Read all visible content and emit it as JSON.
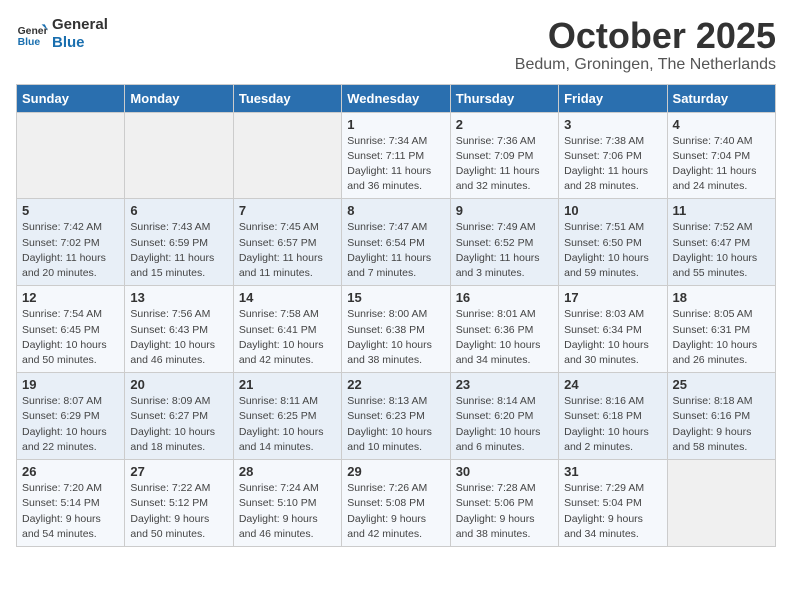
{
  "header": {
    "logo_line1": "General",
    "logo_line2": "Blue",
    "month": "October 2025",
    "location": "Bedum, Groningen, The Netherlands"
  },
  "weekdays": [
    "Sunday",
    "Monday",
    "Tuesday",
    "Wednesday",
    "Thursday",
    "Friday",
    "Saturday"
  ],
  "weeks": [
    [
      {
        "day": "",
        "info": ""
      },
      {
        "day": "",
        "info": ""
      },
      {
        "day": "",
        "info": ""
      },
      {
        "day": "1",
        "info": "Sunrise: 7:34 AM\nSunset: 7:11 PM\nDaylight: 11 hours and 36 minutes."
      },
      {
        "day": "2",
        "info": "Sunrise: 7:36 AM\nSunset: 7:09 PM\nDaylight: 11 hours and 32 minutes."
      },
      {
        "day": "3",
        "info": "Sunrise: 7:38 AM\nSunset: 7:06 PM\nDaylight: 11 hours and 28 minutes."
      },
      {
        "day": "4",
        "info": "Sunrise: 7:40 AM\nSunset: 7:04 PM\nDaylight: 11 hours and 24 minutes."
      }
    ],
    [
      {
        "day": "5",
        "info": "Sunrise: 7:42 AM\nSunset: 7:02 PM\nDaylight: 11 hours and 20 minutes."
      },
      {
        "day": "6",
        "info": "Sunrise: 7:43 AM\nSunset: 6:59 PM\nDaylight: 11 hours and 15 minutes."
      },
      {
        "day": "7",
        "info": "Sunrise: 7:45 AM\nSunset: 6:57 PM\nDaylight: 11 hours and 11 minutes."
      },
      {
        "day": "8",
        "info": "Sunrise: 7:47 AM\nSunset: 6:54 PM\nDaylight: 11 hours and 7 minutes."
      },
      {
        "day": "9",
        "info": "Sunrise: 7:49 AM\nSunset: 6:52 PM\nDaylight: 11 hours and 3 minutes."
      },
      {
        "day": "10",
        "info": "Sunrise: 7:51 AM\nSunset: 6:50 PM\nDaylight: 10 hours and 59 minutes."
      },
      {
        "day": "11",
        "info": "Sunrise: 7:52 AM\nSunset: 6:47 PM\nDaylight: 10 hours and 55 minutes."
      }
    ],
    [
      {
        "day": "12",
        "info": "Sunrise: 7:54 AM\nSunset: 6:45 PM\nDaylight: 10 hours and 50 minutes."
      },
      {
        "day": "13",
        "info": "Sunrise: 7:56 AM\nSunset: 6:43 PM\nDaylight: 10 hours and 46 minutes."
      },
      {
        "day": "14",
        "info": "Sunrise: 7:58 AM\nSunset: 6:41 PM\nDaylight: 10 hours and 42 minutes."
      },
      {
        "day": "15",
        "info": "Sunrise: 8:00 AM\nSunset: 6:38 PM\nDaylight: 10 hours and 38 minutes."
      },
      {
        "day": "16",
        "info": "Sunrise: 8:01 AM\nSunset: 6:36 PM\nDaylight: 10 hours and 34 minutes."
      },
      {
        "day": "17",
        "info": "Sunrise: 8:03 AM\nSunset: 6:34 PM\nDaylight: 10 hours and 30 minutes."
      },
      {
        "day": "18",
        "info": "Sunrise: 8:05 AM\nSunset: 6:31 PM\nDaylight: 10 hours and 26 minutes."
      }
    ],
    [
      {
        "day": "19",
        "info": "Sunrise: 8:07 AM\nSunset: 6:29 PM\nDaylight: 10 hours and 22 minutes."
      },
      {
        "day": "20",
        "info": "Sunrise: 8:09 AM\nSunset: 6:27 PM\nDaylight: 10 hours and 18 minutes."
      },
      {
        "day": "21",
        "info": "Sunrise: 8:11 AM\nSunset: 6:25 PM\nDaylight: 10 hours and 14 minutes."
      },
      {
        "day": "22",
        "info": "Sunrise: 8:13 AM\nSunset: 6:23 PM\nDaylight: 10 hours and 10 minutes."
      },
      {
        "day": "23",
        "info": "Sunrise: 8:14 AM\nSunset: 6:20 PM\nDaylight: 10 hours and 6 minutes."
      },
      {
        "day": "24",
        "info": "Sunrise: 8:16 AM\nSunset: 6:18 PM\nDaylight: 10 hours and 2 minutes."
      },
      {
        "day": "25",
        "info": "Sunrise: 8:18 AM\nSunset: 6:16 PM\nDaylight: 9 hours and 58 minutes."
      }
    ],
    [
      {
        "day": "26",
        "info": "Sunrise: 7:20 AM\nSunset: 5:14 PM\nDaylight: 9 hours and 54 minutes."
      },
      {
        "day": "27",
        "info": "Sunrise: 7:22 AM\nSunset: 5:12 PM\nDaylight: 9 hours and 50 minutes."
      },
      {
        "day": "28",
        "info": "Sunrise: 7:24 AM\nSunset: 5:10 PM\nDaylight: 9 hours and 46 minutes."
      },
      {
        "day": "29",
        "info": "Sunrise: 7:26 AM\nSunset: 5:08 PM\nDaylight: 9 hours and 42 minutes."
      },
      {
        "day": "30",
        "info": "Sunrise: 7:28 AM\nSunset: 5:06 PM\nDaylight: 9 hours and 38 minutes."
      },
      {
        "day": "31",
        "info": "Sunrise: 7:29 AM\nSunset: 5:04 PM\nDaylight: 9 hours and 34 minutes."
      },
      {
        "day": "",
        "info": ""
      }
    ]
  ]
}
